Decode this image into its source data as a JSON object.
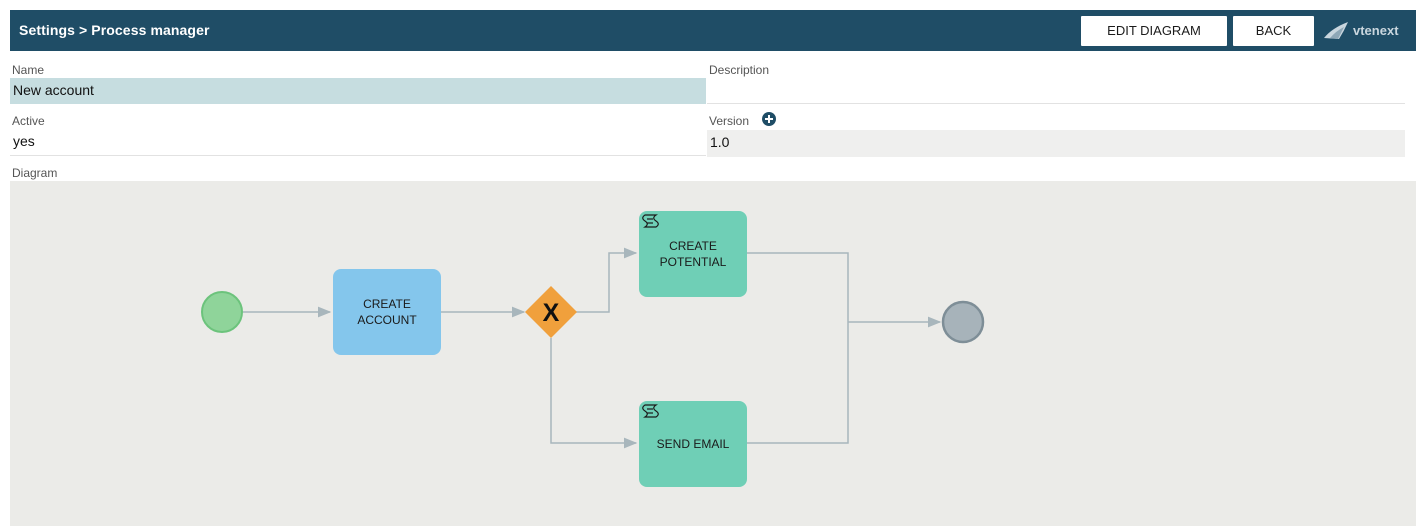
{
  "header": {
    "breadcrumb": "Settings > Process manager",
    "edit_diagram_label": "EDIT DIAGRAM",
    "back_label": "BACK",
    "logo_text": "vtenext"
  },
  "form": {
    "name_label": "Name",
    "name_value": "New account",
    "description_label": "Description",
    "description_value": "",
    "active_label": "Active",
    "active_value": "yes",
    "version_label": "Version",
    "version_value": "1.0",
    "diagram_label": "Diagram"
  },
  "diagram": {
    "tasks": {
      "create_account": [
        "CREATE",
        "ACCOUNT"
      ],
      "create_potential": [
        "CREATE",
        "POTENTIAL"
      ],
      "send_email": [
        "SEND EMAIL"
      ]
    },
    "gateway_symbol": "X",
    "colors": {
      "header": "#1f4d66",
      "start_event": "#8fd49a",
      "end_event": "#a7b3ba",
      "task_blue": "#84c6ec",
      "task_teal": "#6fcfb6",
      "gateway": "#f0a03c",
      "connector": "#a8b6bc"
    },
    "icons": [
      "plus-icon",
      "script-icon",
      "logo-icon"
    ]
  }
}
